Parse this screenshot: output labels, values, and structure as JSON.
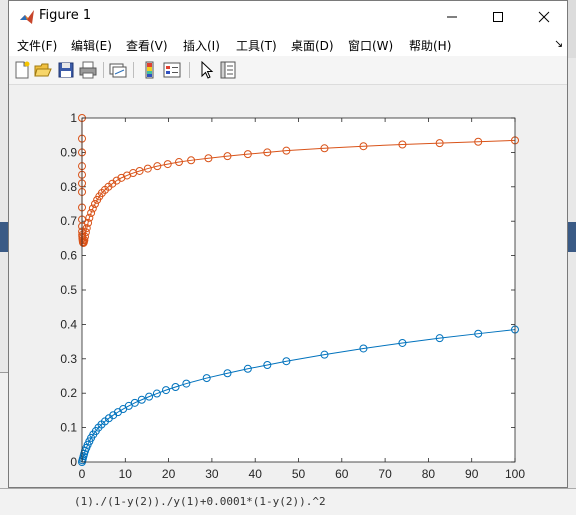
{
  "window": {
    "title": "Figure 1",
    "controls": [
      "minimize",
      "maximize",
      "close"
    ]
  },
  "menu": {
    "items": [
      "文件(F)",
      "编辑(E)",
      "查看(V)",
      "插入(I)",
      "工具(T)",
      "桌面(D)",
      "窗口(W)",
      "帮助(H)"
    ]
  },
  "toolbar": {
    "icons": [
      "new-figure-icon",
      "open-icon",
      "save-icon",
      "print-icon",
      "link-plot-icon",
      "colorbar-icon",
      "legend-icon",
      "pointer-icon",
      "property-inspector-icon"
    ]
  },
  "background": {
    "command_fragment": "(1)./(1-y(2))./y(1)+0.0001*(1-y(2)).^2"
  },
  "colors": {
    "series1": "#d95319",
    "series2": "#0072bd",
    "axes_bg": "#ffffff",
    "figure_bg": "#f0f0f0"
  },
  "chart_data": {
    "type": "line",
    "title": "",
    "xlabel": "",
    "ylabel": "",
    "xlim": [
      0,
      100
    ],
    "ylim": [
      0,
      1
    ],
    "xticks": [
      0,
      10,
      20,
      30,
      40,
      50,
      60,
      70,
      80,
      90,
      100
    ],
    "yticks": [
      0,
      0.1,
      0.2,
      0.3,
      0.4,
      0.5,
      0.6,
      0.7,
      0.8,
      0.9,
      1
    ],
    "xtick_labels": [
      "0",
      "10",
      "20",
      "30",
      "40",
      "50",
      "60",
      "70",
      "80",
      "90",
      "100"
    ],
    "ytick_labels": [
      "0",
      "0.1",
      "0.2",
      "0.3",
      "0.4",
      "0.5",
      "0.6",
      "0.7",
      "0.8",
      "0.9",
      "1"
    ],
    "grid": false,
    "marker": "circle",
    "series": [
      {
        "color": "#d95319",
        "x": [
          0,
          5e-05,
          0.0001,
          0.0002,
          0.0005,
          0.001,
          0.002,
          0.004,
          0.007,
          0.01,
          0.02,
          0.04,
          0.07,
          0.1,
          0.15,
          0.2,
          0.25,
          0.3,
          0.35,
          0.45,
          0.55,
          0.7,
          0.9,
          1.1,
          1.4,
          1.7,
          2.1,
          2.5,
          3.0,
          3.5,
          4.0,
          4.6,
          5.3,
          6.1,
          7.0,
          8.0,
          9.1,
          10.4,
          11.8,
          13.3,
          15.2,
          17.4,
          19.8,
          22.4,
          25.2,
          29.2,
          33.6,
          38.3,
          42.8,
          47.2,
          56.0,
          65.0,
          74.0,
          82.6,
          91.5,
          100
        ],
        "y": [
          1.0,
          0.94,
          0.9,
          0.86,
          0.835,
          0.81,
          0.785,
          0.74,
          0.705,
          0.685,
          0.67,
          0.66,
          0.655,
          0.65,
          0.645,
          0.64,
          0.638,
          0.637,
          0.637,
          0.64,
          0.645,
          0.655,
          0.668,
          0.68,
          0.695,
          0.71,
          0.724,
          0.737,
          0.75,
          0.762,
          0.772,
          0.782,
          0.791,
          0.8,
          0.809,
          0.818,
          0.826,
          0.833,
          0.84,
          0.846,
          0.853,
          0.86,
          0.866,
          0.872,
          0.877,
          0.883,
          0.889,
          0.895,
          0.9,
          0.905,
          0.912,
          0.918,
          0.923,
          0.927,
          0.931,
          0.935
        ]
      },
      {
        "color": "#0072bd",
        "x": [
          0,
          0.1,
          0.2,
          0.35,
          0.5,
          0.7,
          1.0,
          1.3,
          1.7,
          2.1,
          2.6,
          3.2,
          3.8,
          4.5,
          5.3,
          6.2,
          7.2,
          8.3,
          9.5,
          10.8,
          12.2,
          13.8,
          15.5,
          17.3,
          19.4,
          21.6,
          24.1,
          28.8,
          33.6,
          38.3,
          42.8,
          47.2,
          56.0,
          65.0,
          74.0,
          82.6,
          91.5,
          100
        ],
        "y": [
          0.0,
          0.005,
          0.01,
          0.017,
          0.024,
          0.032,
          0.041,
          0.05,
          0.06,
          0.07,
          0.08,
          0.09,
          0.1,
          0.109,
          0.118,
          0.127,
          0.136,
          0.145,
          0.154,
          0.163,
          0.172,
          0.181,
          0.19,
          0.199,
          0.209,
          0.218,
          0.228,
          0.244,
          0.258,
          0.271,
          0.282,
          0.293,
          0.312,
          0.33,
          0.346,
          0.36,
          0.373,
          0.385
        ]
      }
    ]
  }
}
